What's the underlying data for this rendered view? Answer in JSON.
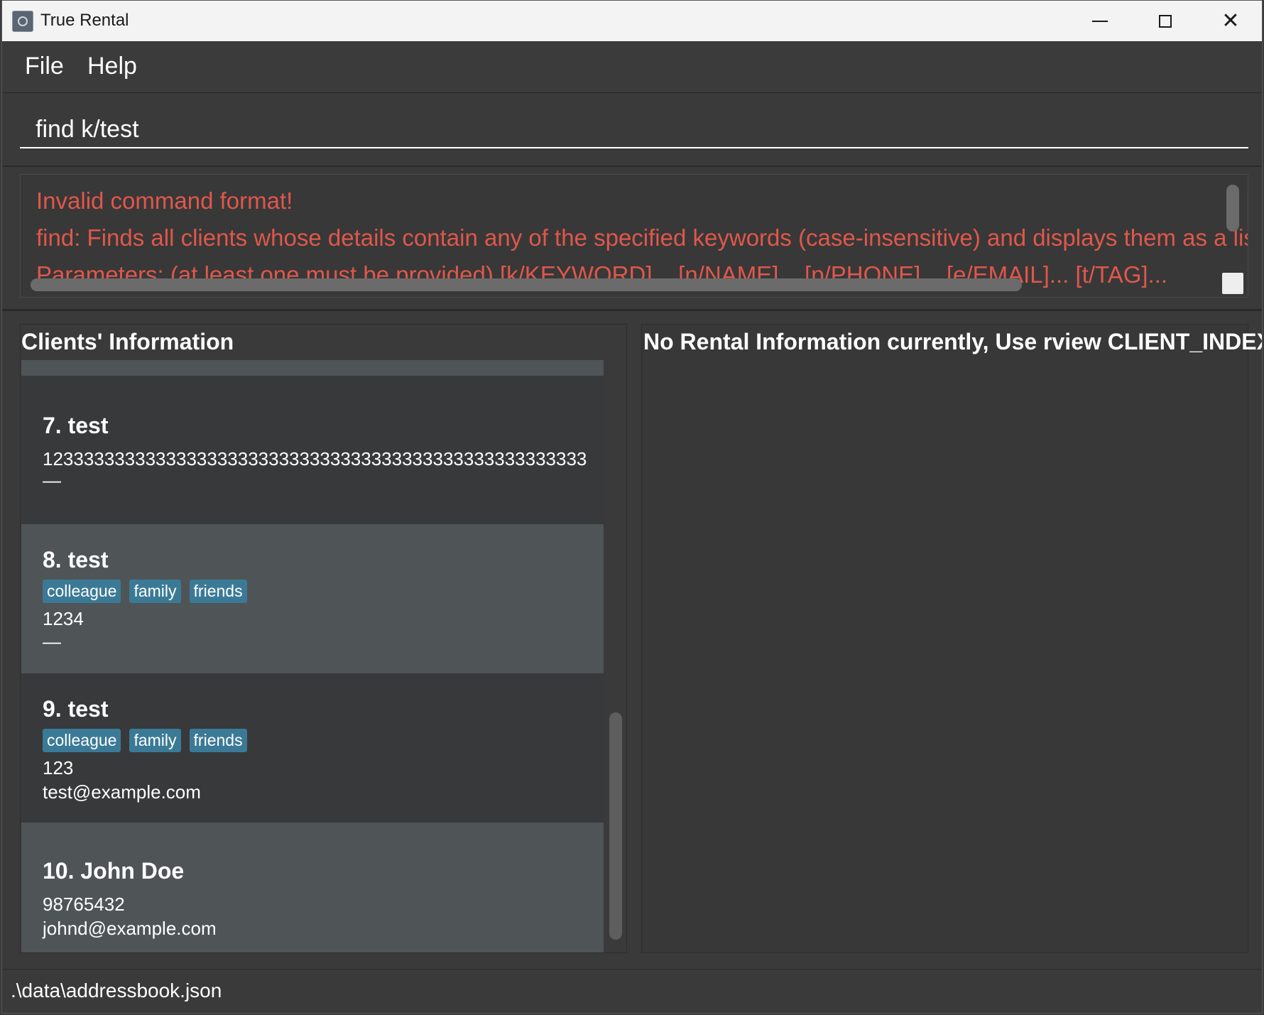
{
  "window": {
    "title": "True Rental",
    "icon": "app-icon",
    "controls": [
      "minimize-icon",
      "maximize-icon",
      "close-icon"
    ]
  },
  "menu": {
    "file": "File",
    "help": "Help"
  },
  "command": {
    "value": "find k/test"
  },
  "result": {
    "line1": "Invalid command format!",
    "line2": "find: Finds all clients whose details contain any of the specified keywords (case-insensitive) and displays them as a lis",
    "line3": "Parameters: (at least one must be provided) [k/KEYWORD]... [n/NAME]... [p/PHONE]... [e/EMAIL]... [t/TAG]..."
  },
  "clients": {
    "title": "Clients' Information",
    "items": [
      {
        "name": "7. test",
        "tags": [],
        "phone": "12333333333333333333333333333333333333333333333333333",
        "email": "—"
      },
      {
        "name": "8. test",
        "tags": [
          "colleague",
          "family",
          "friends"
        ],
        "phone": "1234",
        "email": "—"
      },
      {
        "name": "9. test",
        "tags": [
          "colleague",
          "family",
          "friends"
        ],
        "phone": "123",
        "email": "test@example.com"
      },
      {
        "name": "10. John Doe",
        "tags": [],
        "phone": "98765432",
        "email": "johnd@example.com"
      }
    ]
  },
  "rental": {
    "title": "No Rental Information currently, Use rview CLIENT_INDEX"
  },
  "status": {
    "path": ".\\data\\addressbook.json"
  },
  "colors": {
    "tag": "#3b7a96",
    "error": "#e0574b",
    "card_dark": "#38393b",
    "card_light": "#4f5457"
  }
}
